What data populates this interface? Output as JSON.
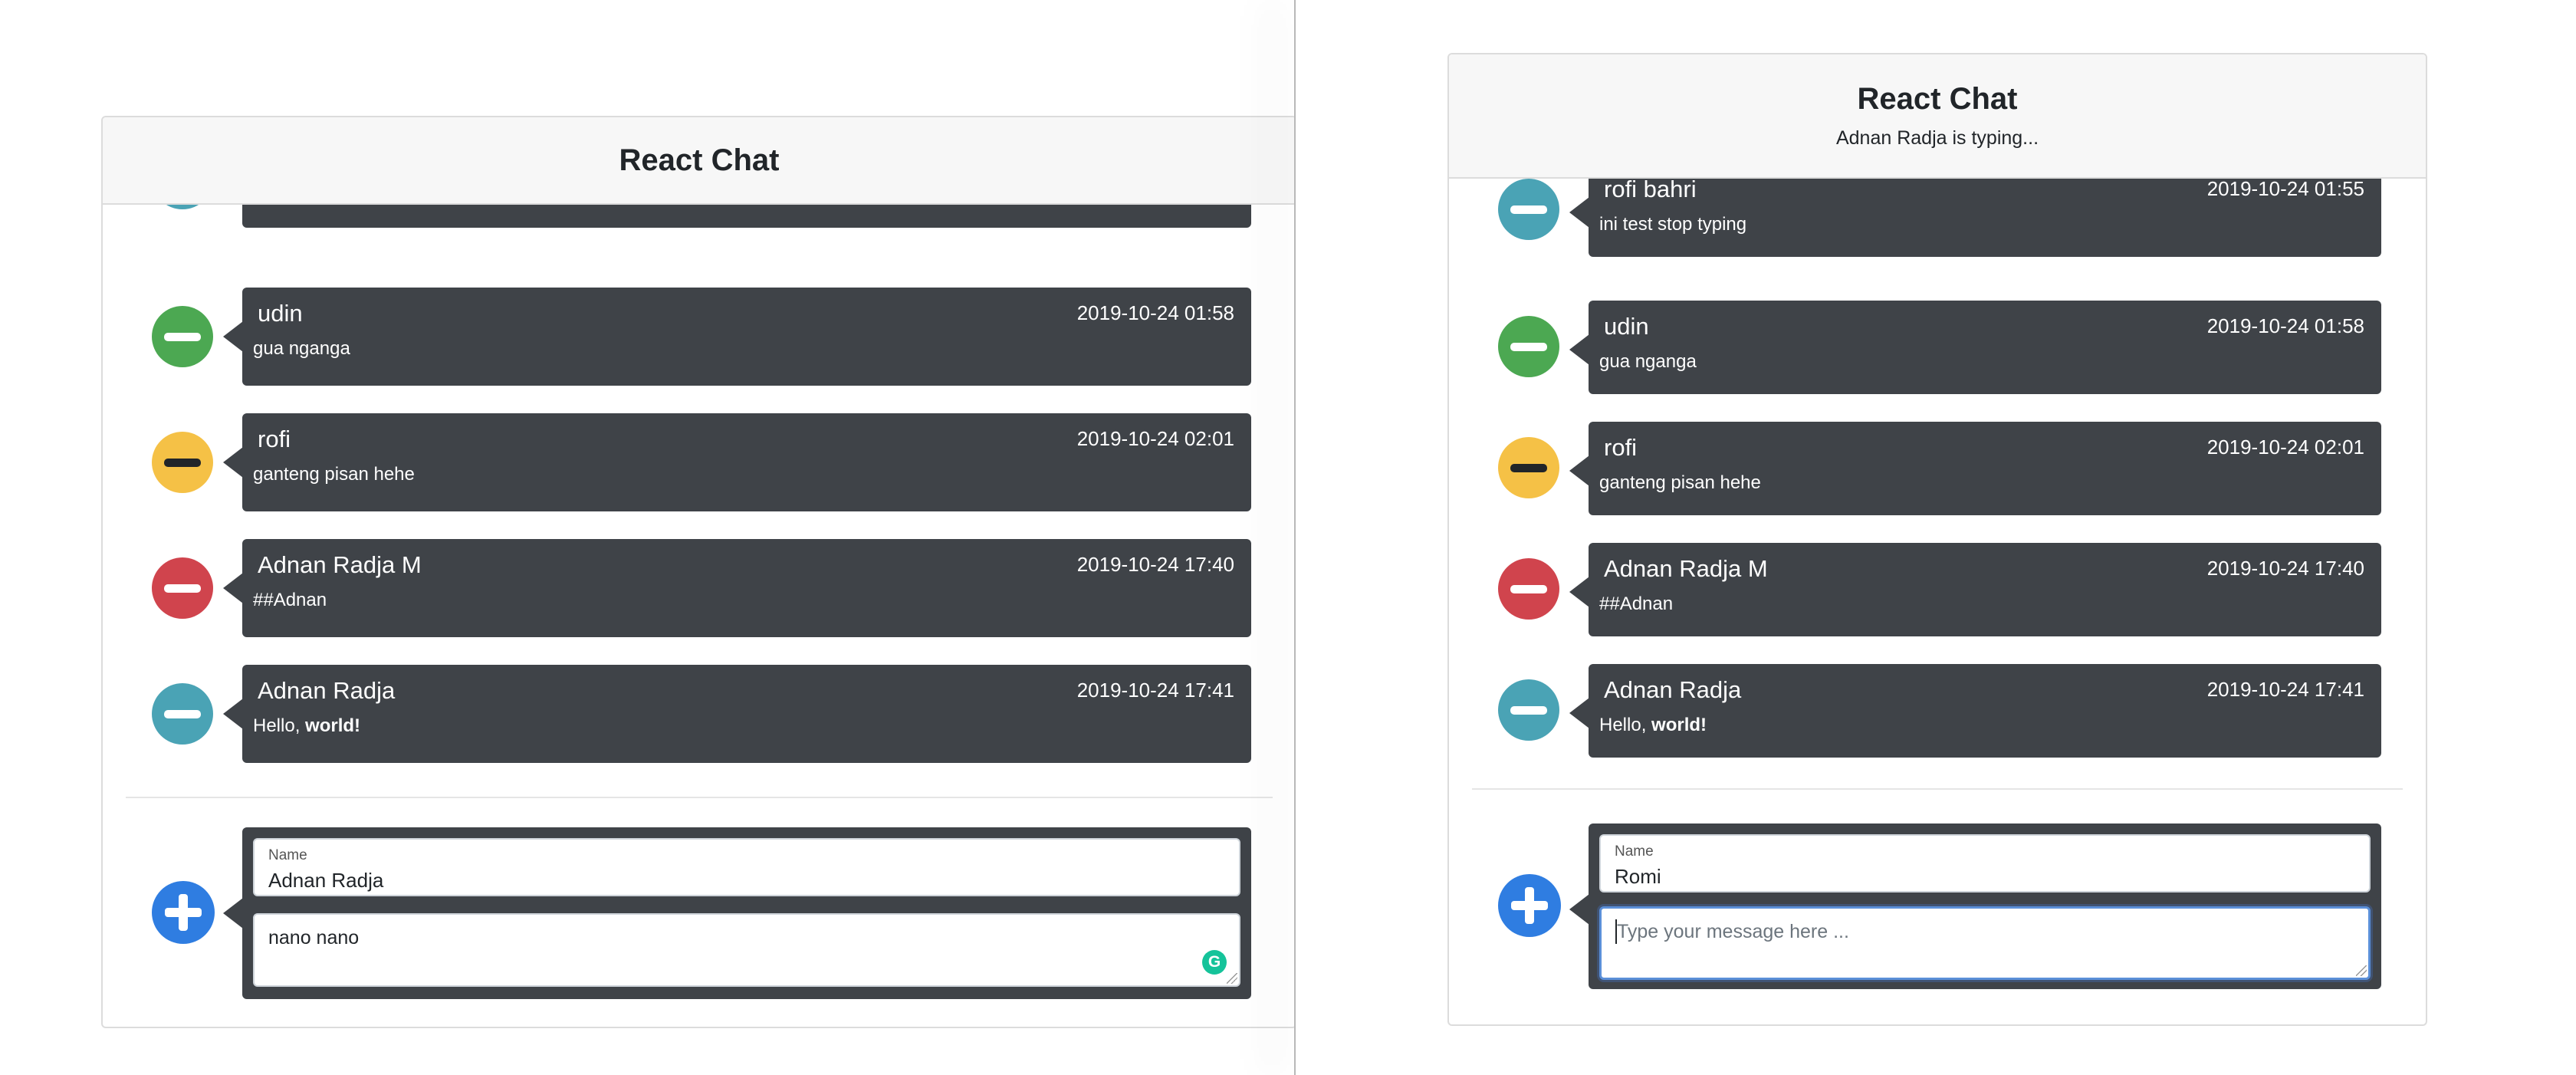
{
  "windows": [
    {
      "title": "React Chat",
      "typing": "",
      "messages": [
        {
          "name": "",
          "time": "",
          "text": "",
          "color": "#4aa3b5"
        },
        {
          "name": "udin",
          "time": "2019-10-24 01:58",
          "text": "gua nganga",
          "color": "#4ca852"
        },
        {
          "name": "rofi",
          "time": "2019-10-24 02:01",
          "text": "ganteng pisan hehe",
          "color": "#f5c146"
        },
        {
          "name": "Adnan Radja M",
          "time": "2019-10-24 17:40",
          "text": "##Adnan",
          "color": "#d0444d"
        },
        {
          "name": "Adnan Radja",
          "time": "2019-10-24 17:41",
          "text_plain": "Hello, ",
          "text_bold": "world!",
          "color": "#4aa3b5"
        }
      ],
      "form": {
        "name_label": "Name",
        "name_value": "Adnan Radja",
        "message_value": "nano nano",
        "grammarly_glyph": "G",
        "placeholder": ""
      }
    },
    {
      "title": "React Chat",
      "typing": "Adnan Radja is typing...",
      "messages": [
        {
          "name": "rofi bahri",
          "time": "2019-10-24 01:55",
          "text": "ini test stop typing",
          "color": "#4aa3b5"
        },
        {
          "name": "udin",
          "time": "2019-10-24 01:58",
          "text": "gua nganga",
          "color": "#4ca852"
        },
        {
          "name": "rofi",
          "time": "2019-10-24 02:01",
          "text": "ganteng pisan hehe",
          "color": "#f5c146"
        },
        {
          "name": "Adnan Radja M",
          "time": "2019-10-24 17:40",
          "text": "##Adnan",
          "color": "#d0444d"
        },
        {
          "name": "Adnan Radja",
          "time": "2019-10-24 17:41",
          "text_plain": "Hello, ",
          "text_bold": "world!",
          "color": "#4aa3b5"
        }
      ],
      "form": {
        "name_label": "Name",
        "name_value": "Romi",
        "message_value": "",
        "placeholder": "Type your message here ..."
      }
    }
  ],
  "colors": {
    "bubble": "#3f4348",
    "add_button": "#2f7de1",
    "grammarly": "#15c39a"
  },
  "icons": {
    "message_avatar": "minus-circle-icon",
    "add": "plus-circle-icon",
    "grammarly": "grammarly-icon"
  }
}
